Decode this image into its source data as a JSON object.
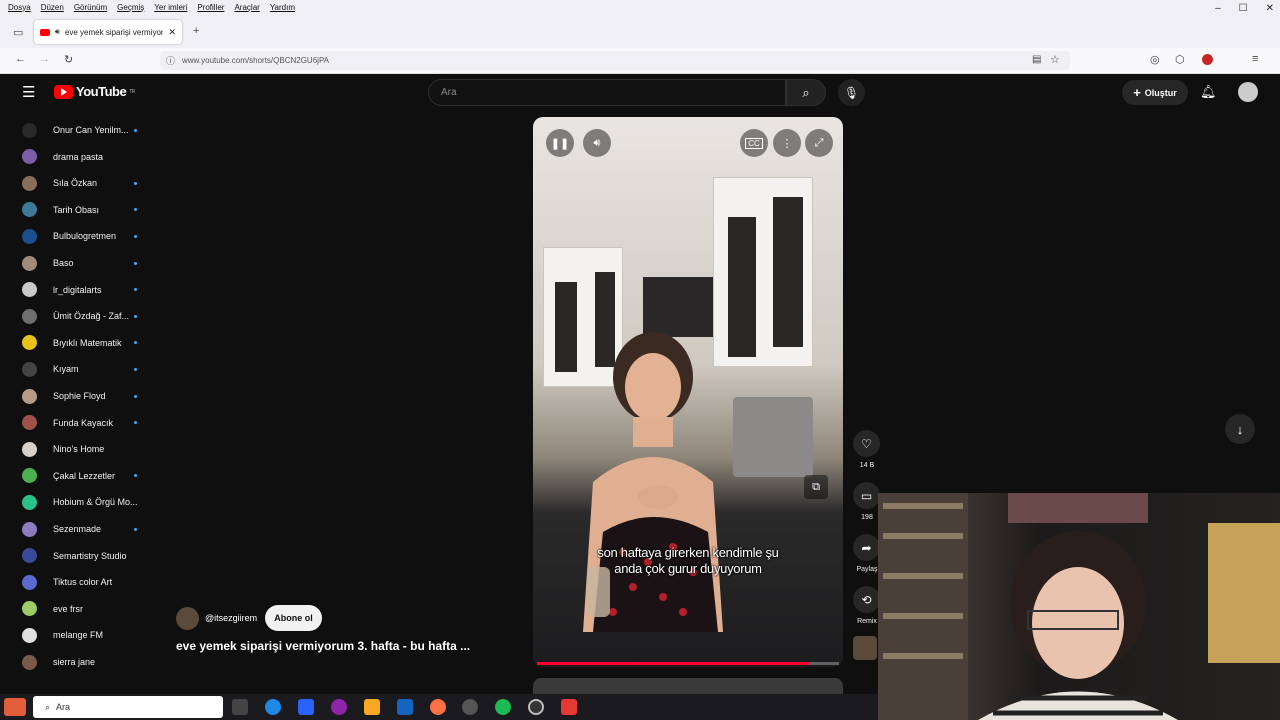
{
  "browser": {
    "menu": [
      "Dosya",
      "Düzen",
      "Görünüm",
      "Geçmiş",
      "Yer imleri",
      "Profiller",
      "Araçlar",
      "Yardım"
    ],
    "tab_title": "eve yemek siparişi vermiyor",
    "url": "www.youtube.com/shorts/QBCN2GU6jPA",
    "window_controls": [
      "–",
      "☐",
      "✕"
    ]
  },
  "header": {
    "logo_text": "YouTube",
    "logo_sup": "TR",
    "search_placeholder": "Ara",
    "create_label": "Oluştur"
  },
  "sidebar": {
    "items": [
      {
        "label": "Onur Can Yenilm...",
        "dot": true,
        "color": "#2a2a2a"
      },
      {
        "label": "drama pasta",
        "dot": false,
        "color": "#7b5ea7"
      },
      {
        "label": "Sıla Özkan",
        "dot": true,
        "color": "#8a6e5a"
      },
      {
        "label": "Tarih Obası",
        "dot": true,
        "color": "#3d7a9a"
      },
      {
        "label": "Bulbulogretmen",
        "dot": true,
        "color": "#1b4f8c"
      },
      {
        "label": "Baso",
        "dot": true,
        "color": "#a08a7a"
      },
      {
        "label": "lr_digitalarts",
        "dot": true,
        "color": "#c9c9c9"
      },
      {
        "label": "Ümit Özdağ - Zaf...",
        "dot": true,
        "color": "#6e6e6e"
      },
      {
        "label": "Bıyıklı Matematik",
        "dot": true,
        "color": "#e8c21a"
      },
      {
        "label": "Kıyam",
        "dot": true,
        "color": "#444444"
      },
      {
        "label": "Sophie Floyd",
        "dot": true,
        "color": "#b69a84"
      },
      {
        "label": "Funda Kayacık",
        "dot": true,
        "color": "#a0524a"
      },
      {
        "label": "Nino's Home",
        "dot": false,
        "color": "#d8d0c8"
      },
      {
        "label": "Çakal Lezzetler",
        "dot": true,
        "color": "#4caf50"
      },
      {
        "label": "Hobium & Örgü Mo...",
        "dot": false,
        "color": "#28c28a"
      },
      {
        "label": "Sezenmade",
        "dot": true,
        "color": "#8e7cc3"
      },
      {
        "label": "Semartistry Studio",
        "dot": false,
        "color": "#3a4a9a"
      },
      {
        "label": "Tiktus color Art",
        "dot": false,
        "color": "#5a6ad0"
      },
      {
        "label": "eve frsr",
        "dot": false,
        "color": "#9ccc65"
      },
      {
        "label": "melange FM",
        "dot": false,
        "color": "#e0e0e0"
      },
      {
        "label": "sierra jane",
        "dot": false,
        "color": "#7a5a4a"
      }
    ]
  },
  "video": {
    "caption_line1": "son haftaya girerken kendimle şu",
    "caption_line2": "anda çok gurur duyuyorum",
    "progress": 0.9
  },
  "actions": {
    "likes": "14 B",
    "comments": "198",
    "share_label": "Paylaş",
    "remix_label": "Remix"
  },
  "channel": {
    "handle": "@itsezgiirem",
    "subscribe_label": "Abone ol",
    "title": "eve yemek siparişi vermiyorum 3. hafta - bu hafta ..."
  },
  "taskbar": {
    "search_text": "Ara"
  }
}
